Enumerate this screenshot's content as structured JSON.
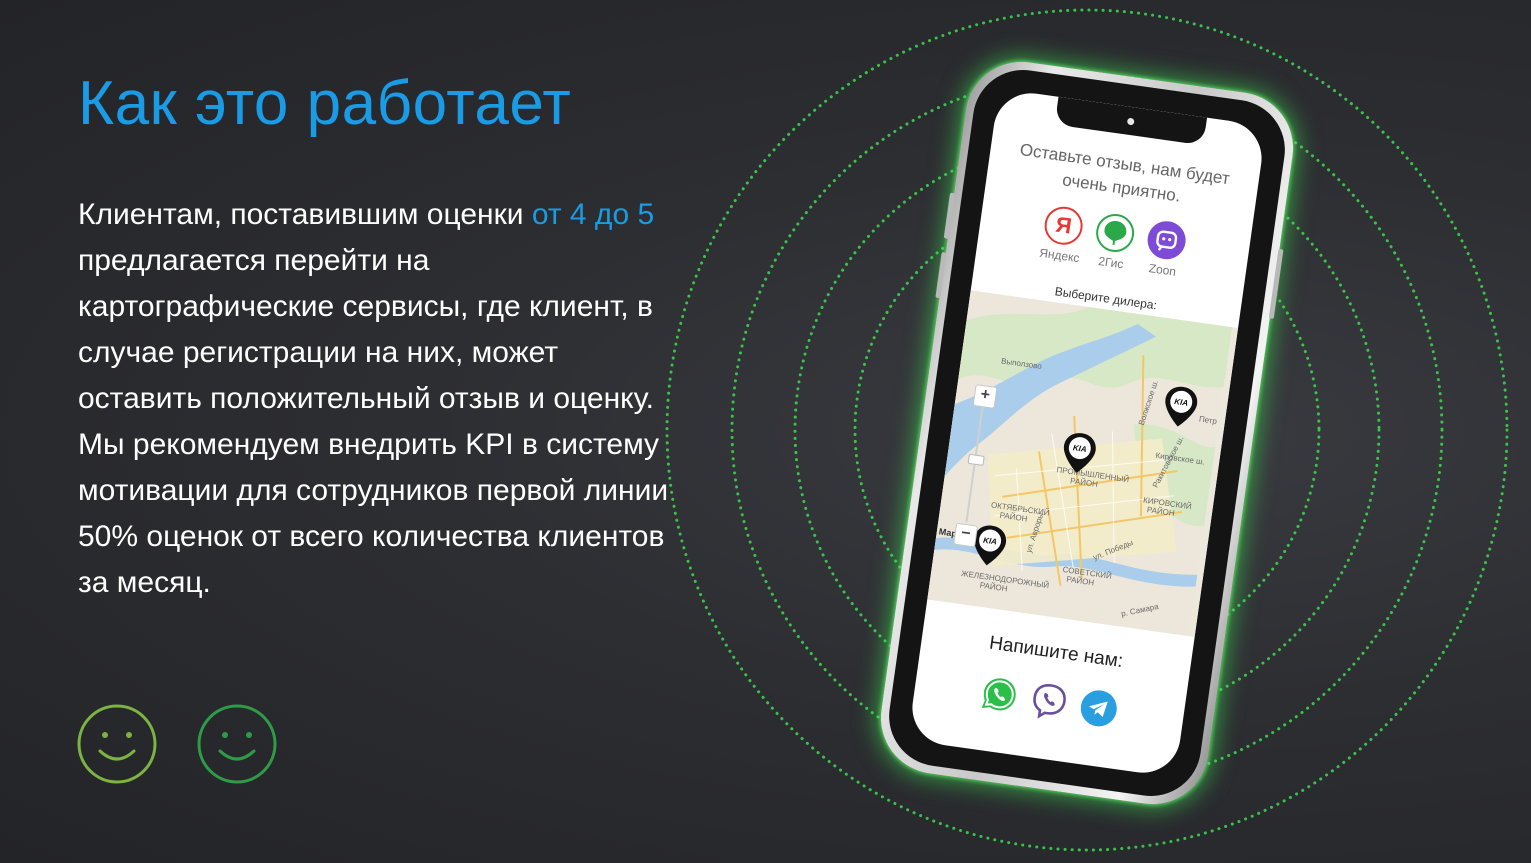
{
  "slide": {
    "title": "Как это работает",
    "body_part1": "Клиентам, поставившим оценки ",
    "body_highlight": "от 4 до 5",
    "body_part2": " предлагается перейти на картографические сервисы, где клиент, в случае регистрации на них, может оставить положительный отзыв и оценку. Мы рекомендуем внедрить KPI в систему мотивации для сотрудников первой линии 50% оценок от всего количества клиентов за месяц.",
    "smileys": [
      "smiley-face-icon",
      "smiley-face-icon"
    ]
  },
  "colors": {
    "accent_blue": "#1a9be6",
    "glow_green": "#3ddc50",
    "smiley_left": "#7cb342",
    "smiley_right": "#2e9b47",
    "background": "#2d2e32"
  },
  "phone": {
    "review_prompt": "Оставьте отзыв, нам будет очень приятно.",
    "services": [
      {
        "label": "Яндекс",
        "icon": "yandex-icon",
        "glyph": "Я"
      },
      {
        "label": "2Гис",
        "icon": "2gis-icon"
      },
      {
        "label": "Zoon",
        "icon": "zoon-icon"
      }
    ],
    "dealer_label": "Выберите дилера:",
    "map": {
      "zoom_in": "+",
      "zoom_out": "−",
      "labels": {
        "vypolzovo": "Выползово",
        "promyshlenny": "ПРОМЫШЛЕННЫЙ",
        "rayon1": "РАЙОН",
        "oktyabrsky": "ОКТЯБРЬСКИЙ",
        "rayon2": "РАЙОН",
        "kirovsky": "КИРОВСКИЙ",
        "rayon3": "РАЙОН",
        "sovetsky": "СОВЕТСКИЙ",
        "rayon4": "РАЙОН",
        "zheleznodorozhny": "ЖЕЛЕЗНОДОРОЖНЫЙ",
        "rayon5": "РАЙОН",
        "ul_avrory": "ул. Авроры",
        "ul_pobedy": "ул. Победы",
        "samara_river": "р. Самара",
        "volzhskoe": "Волжское ш.",
        "rakitovskoe": "Ракитовское ш.",
        "kirovskoe": "Кировское ш.",
        "samara_city": "Мара",
        "petra": "Петр"
      },
      "pins": [
        "kia-dealer-pin-icon",
        "kia-dealer-pin-icon",
        "kia-dealer-pin-icon"
      ],
      "pin_brand": "KIA"
    },
    "write_label": "Напишите нам:",
    "messengers": [
      "whatsapp-icon",
      "viber-icon",
      "telegram-icon"
    ]
  }
}
